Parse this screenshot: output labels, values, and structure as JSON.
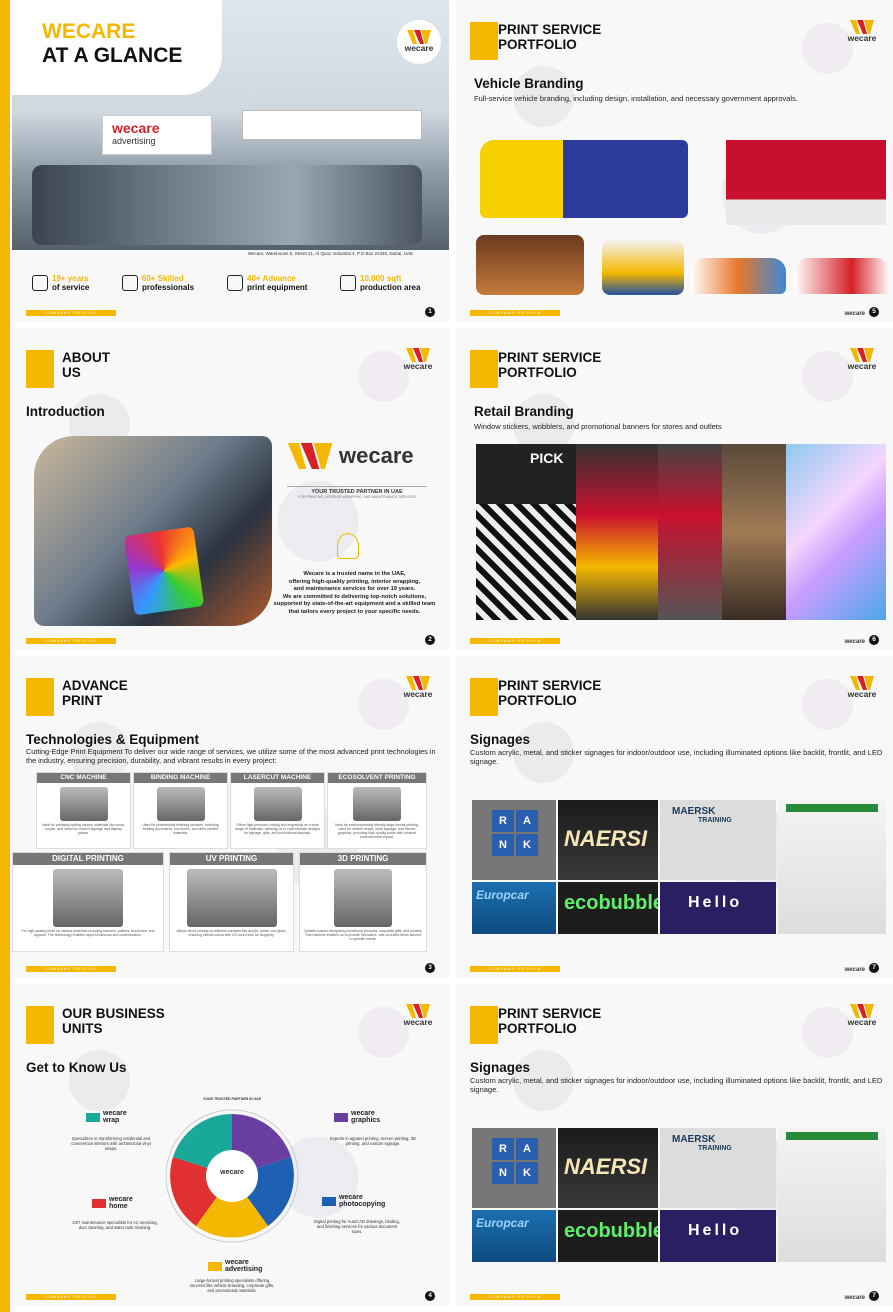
{
  "brand": {
    "name": "wecare",
    "sub": "advertising",
    "footer_label": "COMPANY PROFILE",
    "colors": {
      "yellow": "#f5b800",
      "red": "#d62128"
    }
  },
  "slide1": {
    "title_line1": "WECARE",
    "title_line2": "AT A GLANCE",
    "address": "Wecare, Warehouse 5, Street 21, Al Quoz Industrial 4, P.O Box 22345, Dubai, UAE",
    "stats": [
      {
        "highlight": "19+ years",
        "label": "of service"
      },
      {
        "highlight": "60+ Skilled",
        "label": "professionals"
      },
      {
        "highlight": "40+ Advance",
        "label": "print equipment"
      },
      {
        "highlight": "10,000 sqft",
        "label": "production area"
      }
    ],
    "page": "1"
  },
  "slide2": {
    "title_line1": "ABOUT",
    "title_line2": "US",
    "heading": "Introduction",
    "tagline": "YOUR TRUSTED PARTNER IN UAE",
    "tagline_sub": "FOR PRINTING, INTERIOR WRAPPING, AND MAINTENANCE SERVICES",
    "body_lines": [
      "Wecare is a trusted name in the UAE,",
      "offering high-quality printing, interior wrapping,",
      "and maintenance services for over 19 years.",
      "We are committed to delivering top-notch solutions,",
      "supported by state-of-the-art equipment and a skilled team",
      "that tailors every project to your specific needs."
    ],
    "page": "2"
  },
  "slide3": {
    "title_line1": "ADVANCE",
    "title_line2": "PRINT",
    "heading": "Technologies & Equipment",
    "intro": "Cutting-Edge Print Equipment To deliver our wide range of services, we utilize some of the most advanced print technologies in the industry, ensuring precision, durability, and vibrant results in every project:",
    "machines_top": [
      {
        "name": "CNC MACHINE",
        "desc": "Ideal for precisely cutting various materials like wood, acrylic, and metal for custom signage and display pieces."
      },
      {
        "name": "BINDING MACHINE",
        "desc": "Used for professional finishing services, including binding documents, brochures, and other printed materials."
      },
      {
        "name": "LASERCUT MACHINE",
        "desc": "Offers high-precision cutting and engraving on a wide range of materials, allowing us to craft intricate designs for signage, gifts, and promotional displays."
      },
      {
        "name": "ECOSOLVENT PRINTING",
        "desc": "Ideal for environmentally friendly large-format printing, used for vehicle wraps, retail signage, and interior graphics, providing high-quality prints with minimal environmental impact."
      }
    ],
    "machines_bottom": [
      {
        "name": "DIGITAL PRINTING",
        "desc": "For high-quality prints on various materials including banners, posters, brochures, and apparel. The technology enables rapid turnaround and customization."
      },
      {
        "name": "UV PRINTING",
        "desc": "Allows direct printing on different surfaces like acrylic, metal, and glass, ensuring vibrant colors with UV-cured inks for longevity."
      },
      {
        "name": "3D PRINTING",
        "desc": "Creates custom-designed promotional products, corporate gifts, and models. This machine enables us to provide innovative, one-of-a-kind items tailored to specific needs."
      }
    ],
    "page": "3"
  },
  "slide4": {
    "title_line1": "OUR BUSINESS",
    "title_line2": "UNITS",
    "heading": "Get to Know Us",
    "center_tag": "YOUR TRUSTED PARTNER IN UAE",
    "units": [
      {
        "name": "wecare",
        "sub": "wrap",
        "desc": "Specializes in transforming residential and commercial interiors with architectural vinyl wraps."
      },
      {
        "name": "wecare",
        "sub": "home",
        "desc": "24/7 maintenance specialists for AC servicing, duct cleaning, and water tank cleaning."
      },
      {
        "name": "wecare",
        "sub": "advertising",
        "desc": "Large-format printing specialists offering services like vehicle branding, corporate gifts, and promotional materials."
      },
      {
        "name": "wecare",
        "sub": "photocopying",
        "desc": "Digital printing for AutoCAD drawings, binding, and finishing services for various document sizes."
      },
      {
        "name": "wecare",
        "sub": "graphics",
        "desc": "Experts in apparel printing, screen printing, 3D printing, and custom signage."
      }
    ],
    "page": "4"
  },
  "slide5": {
    "title_line1": "PRINT SERVICE",
    "title_line2": "PORTFOLIO",
    "heading": "Vehicle Branding",
    "sub": "Full-service vehicle branding, including design, installation, and necessary government approvals.",
    "page": "5"
  },
  "slide6": {
    "title_line1": "PRINT SERVICE",
    "title_line2": "PORTFOLIO",
    "heading": "Retail Branding",
    "sub": "Window stickers, wobblers, and promotional banners for stores and outlets",
    "pick": "PICK",
    "page": "6"
  },
  "slide7": {
    "title_line1": "PRINT SERVICE",
    "title_line2": "PORTFOLIO",
    "heading": "Signages",
    "sub": "Custom acrylic, metal, and sticker signages for indoor/outdoor use, including illuminated options like backlit, frontlit, and LED signage.",
    "signs": [
      "R",
      "A",
      "N",
      "K",
      "NAERSI",
      "MAERSK",
      "TRAINING",
      "Europcar",
      "ecobubble",
      "Hello"
    ],
    "page": "7"
  },
  "slide8": {
    "title_line1": "PRINT SERVICE",
    "title_line2": "PORTFOLIO",
    "heading": "Signages",
    "sub": "Custom acrylic, metal, and sticker signages for indoor/outdoor use, including illuminated options like backlit, frontlit, and LED signage.",
    "signs": [
      "R",
      "A",
      "N",
      "K",
      "NAERSI",
      "MAERSK",
      "TRAINING",
      "Europcar",
      "ecobubble",
      "Hello"
    ],
    "page": "7"
  }
}
